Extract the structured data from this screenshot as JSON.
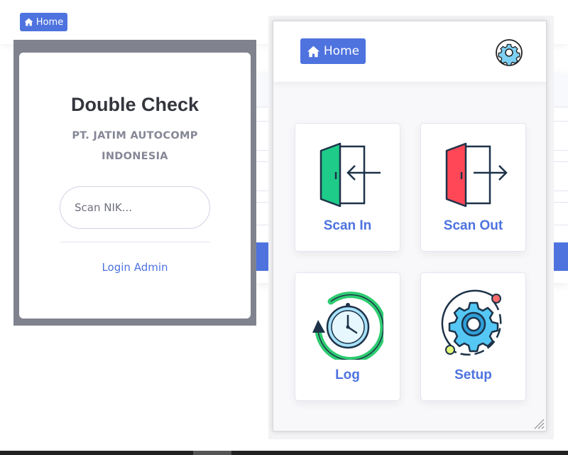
{
  "background_page": {
    "home_button_label": "Home"
  },
  "modal": {
    "title": "Double Check",
    "subtitle": "PT. JATIM AUTOCOMP INDONESIA",
    "scan_input_placeholder": "Scan NIK...",
    "scan_input_value": "",
    "login_admin_label": "Login Admin"
  },
  "panel": {
    "home_button_label": "Home",
    "settings_icon": "gear-icon",
    "tiles": [
      {
        "label": "Scan In",
        "icon": "scan-in-icon",
        "accent": "#1ecb88"
      },
      {
        "label": "Scan Out",
        "icon": "scan-out-icon",
        "accent": "#ff4757"
      },
      {
        "label": "Log",
        "icon": "clock-history-icon",
        "accent": "#2ecc71"
      },
      {
        "label": "Setup",
        "icon": "setup-gear-icon",
        "accent": "#55c7f5"
      }
    ]
  },
  "colors": {
    "primary": "#4e73df",
    "overlay": "#80838e",
    "muted_text": "#858796",
    "title_text": "#34363d"
  }
}
